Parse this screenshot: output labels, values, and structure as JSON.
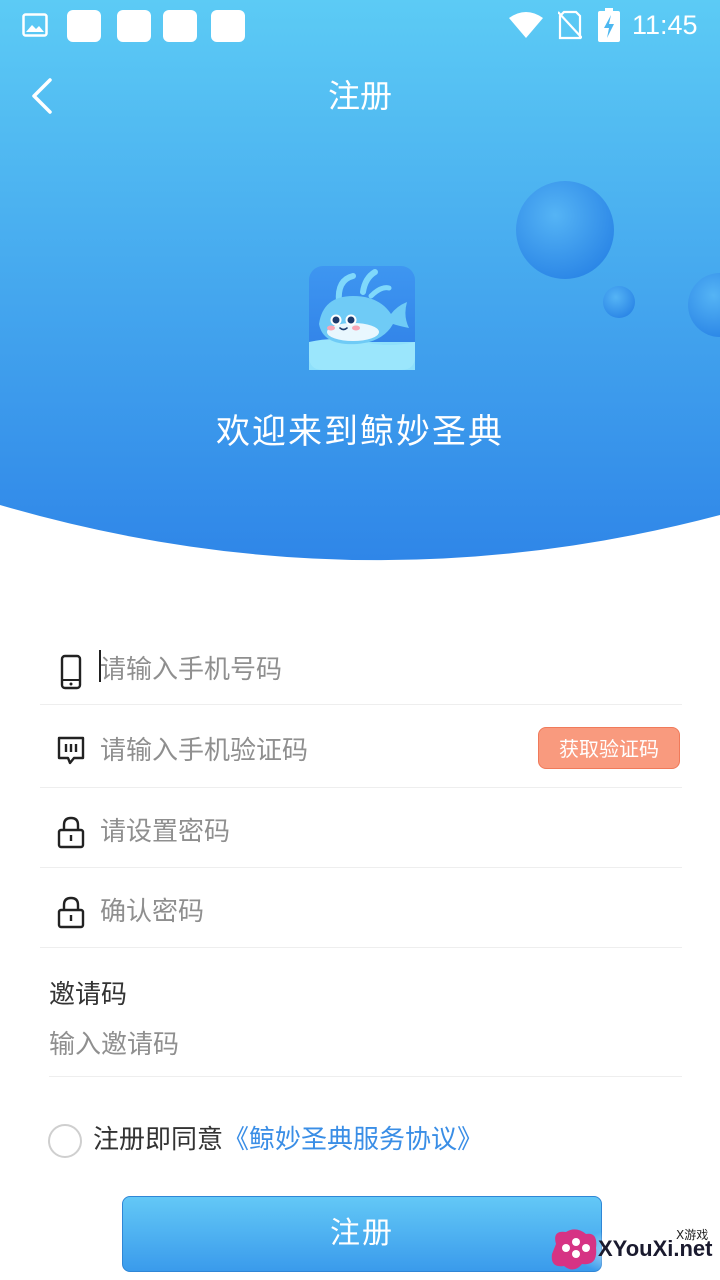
{
  "status_bar": {
    "time": "11:45",
    "icons": [
      "gallery-icon",
      "notification-icon",
      "notification-icon",
      "notification-icon",
      "notification-icon",
      "wifi-icon",
      "no-sim-icon",
      "battery-charging-icon"
    ]
  },
  "nav": {
    "back_icon": "chevron-left-icon",
    "title": "注册"
  },
  "hero": {
    "welcome": "欢迎来到鲸妙圣典"
  },
  "form": {
    "phone": {
      "placeholder": "请输入手机号码",
      "icon": "phone-icon"
    },
    "sms_code": {
      "placeholder": "请输入手机验证码",
      "icon": "message-icon",
      "button_label": "获取验证码"
    },
    "password": {
      "placeholder": "请设置密码",
      "icon": "lock-icon"
    },
    "confirm_password": {
      "placeholder": "确认密码",
      "icon": "lock-icon"
    },
    "invite": {
      "label": "邀请码",
      "placeholder": "输入邀请码"
    }
  },
  "agreement": {
    "prefix": "注册即同意",
    "link": "《鲸妙圣典服务协议》",
    "checked": false
  },
  "submit": {
    "label": "注册"
  },
  "watermark": {
    "text": "XYouXi.net",
    "small": "X游戏"
  },
  "colors": {
    "header_top": "#5ccbf5",
    "header_bottom": "#2f86e8",
    "code_button": "#f99a7e",
    "link": "#3a8ee6",
    "button_top": "#63c8f6",
    "button_bottom": "#3a9bec"
  }
}
